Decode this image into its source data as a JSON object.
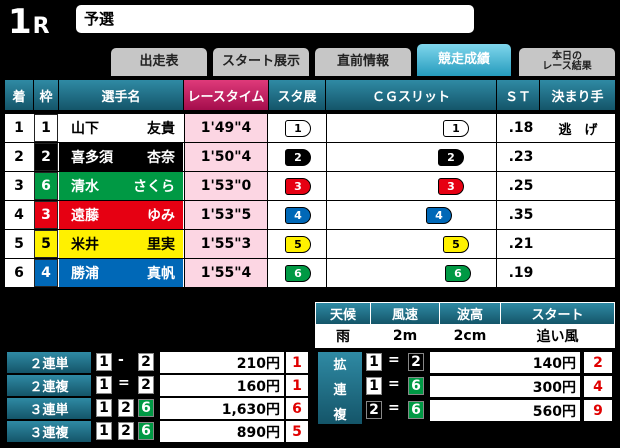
{
  "race": {
    "number": "1",
    "suffix": "R",
    "name": "予選"
  },
  "tabs": [
    {
      "label": "出走表"
    },
    {
      "label": "スタート展示"
    },
    {
      "label": "直前情報"
    },
    {
      "label": "競走成績"
    },
    {
      "label_line1": "本日の",
      "label_line2": "レース結果"
    }
  ],
  "result_headers": {
    "rank": "着",
    "waku": "枠",
    "name": "選手名",
    "time": "レースタイム",
    "st_ex": "スタ展",
    "cg": "ＣＧスリット",
    "st": "ＳＴ",
    "kimarite": "決まり手"
  },
  "colors": {
    "waku_1": "#ffffff",
    "waku_2": "#000000",
    "waku_3": "#e60012",
    "waku_4": "#0068b7",
    "waku_5": "#fff100",
    "waku_6": "#009944",
    "time_bg": "#fcd6e3",
    "header_teal": "#1f6f86",
    "payout_red": "#e00000"
  },
  "results": [
    {
      "rank": "1",
      "waku": "1",
      "last": "山下",
      "first": "友貴",
      "time": "1'49\"4",
      "st_ex": "1",
      "slit": "1",
      "st": ".18",
      "kimarite": "逃　げ"
    },
    {
      "rank": "2",
      "waku": "2",
      "last": "喜多須",
      "first": "杏奈",
      "time": "1'50\"4",
      "st_ex": "2",
      "slit": "2",
      "st": ".23",
      "kimarite": ""
    },
    {
      "rank": "3",
      "waku": "6",
      "last": "清水",
      "first": "さくら",
      "time": "1'53\"0",
      "st_ex": "3",
      "slit": "3",
      "st": ".25",
      "kimarite": ""
    },
    {
      "rank": "4",
      "waku": "3",
      "last": "遠藤",
      "first": "ゆみ",
      "time": "1'53\"5",
      "st_ex": "4",
      "slit": "4",
      "st": ".35",
      "kimarite": ""
    },
    {
      "rank": "5",
      "waku": "5",
      "last": "米井",
      "first": "里実",
      "time": "1'55\"3",
      "st_ex": "5",
      "slit": "5",
      "st": ".21",
      "kimarite": ""
    },
    {
      "rank": "6",
      "waku": "4",
      "last": "勝浦",
      "first": "真帆",
      "time": "1'55\"4",
      "st_ex": "6",
      "slit": "6",
      "st": ".19",
      "kimarite": ""
    }
  ],
  "weather": {
    "headers": {
      "weather": "天候",
      "wind": "風速",
      "wave": "波高",
      "start": "スタート"
    },
    "values": {
      "weather": "雨",
      "wind": "2m",
      "wave": "2cm",
      "start": "追い風"
    }
  },
  "payouts_left": [
    {
      "label": "２連単",
      "a": "1",
      "sep": "-",
      "b": "2",
      "c": "",
      "amount": "210円",
      "pop": "1"
    },
    {
      "label": "２連複",
      "a": "1",
      "sep": "=",
      "b": "2",
      "c": "",
      "amount": "160円",
      "pop": "1"
    },
    {
      "label": "３連単",
      "a": "1",
      "sep": "",
      "b": "2",
      "c": "6",
      "amount": "1,630円",
      "pop": "6"
    },
    {
      "label": "３連複",
      "a": "1",
      "sep": "",
      "b": "2",
      "c": "6",
      "amount": "890円",
      "pop": "5"
    }
  ],
  "payouts_right": {
    "label_chars": [
      "拡",
      "連",
      "複"
    ],
    "rows": [
      {
        "a": "1",
        "sep": "=",
        "b": "2",
        "amount": "140円",
        "pop": "2"
      },
      {
        "a": "1",
        "sep": "=",
        "b": "6",
        "amount": "300円",
        "pop": "4"
      },
      {
        "a": "2",
        "sep": "=",
        "b": "6",
        "amount": "560円",
        "pop": "9"
      }
    ]
  }
}
